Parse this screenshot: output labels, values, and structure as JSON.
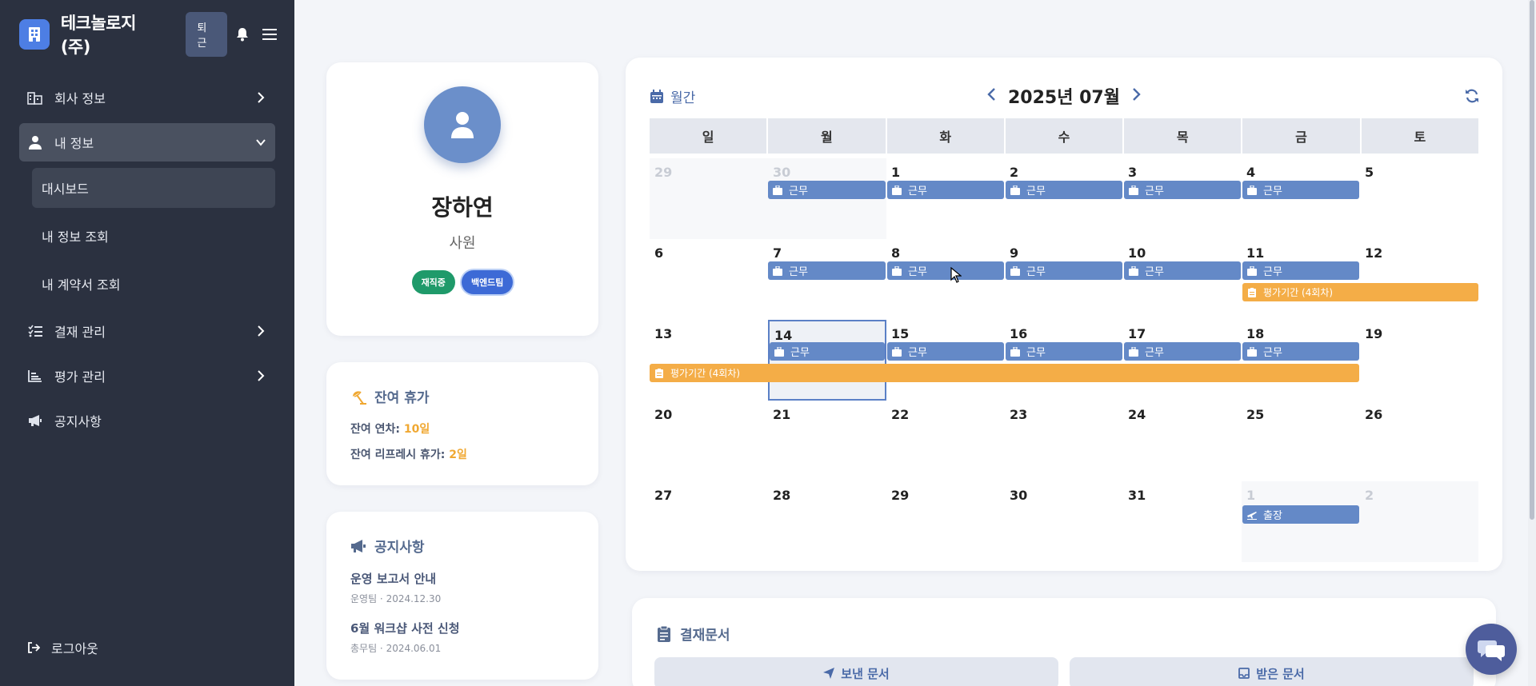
{
  "sidebar": {
    "company": "테크놀로지(주)",
    "checkout_label": "퇴근",
    "menu": [
      {
        "label": "회사 정보",
        "icon": "building-icon"
      },
      {
        "label": "내 정보",
        "icon": "user-icon"
      },
      {
        "label": "결재 관리",
        "icon": "checklist-icon"
      },
      {
        "label": "평가 관리",
        "icon": "chart-icon"
      },
      {
        "label": "공지사항",
        "icon": "megaphone-icon"
      }
    ],
    "submenu": [
      {
        "label": "대시보드"
      },
      {
        "label": "내 정보 조회"
      },
      {
        "label": "내 계약서 조회"
      }
    ],
    "logout_label": "로그아웃"
  },
  "profile": {
    "name": "장하연",
    "rank": "사원",
    "status_badge": "재직중",
    "team_badge": "백엔드팀"
  },
  "leave": {
    "title": "잔여 휴가",
    "annual_label": "잔여 연차:",
    "annual_value": "10일",
    "refresh_label": "잔여 리프레시 휴가:",
    "refresh_value": "2일"
  },
  "notice": {
    "title": "공지사항",
    "items": [
      {
        "title": "운영 보고서 안내",
        "meta": "운영팀 · 2024.12.30"
      },
      {
        "title": "6월 워크샵 사전 신청",
        "meta": "총무팀 · 2024.06.01"
      }
    ]
  },
  "calendar": {
    "mode_label": "월간",
    "title": "2025년 07월",
    "weekdays": [
      "일",
      "월",
      "화",
      "수",
      "목",
      "금",
      "토"
    ],
    "weeks": [
      [
        "29",
        "30",
        "1",
        "2",
        "3",
        "4",
        "5"
      ],
      [
        "6",
        "7",
        "8",
        "9",
        "10",
        "11",
        "12"
      ],
      [
        "13",
        "14",
        "15",
        "16",
        "17",
        "18",
        "19"
      ],
      [
        "20",
        "21",
        "22",
        "23",
        "24",
        "25",
        "26"
      ],
      [
        "27",
        "28",
        "29",
        "30",
        "31",
        "1",
        "2"
      ]
    ],
    "work_label": "근무",
    "eval_label": "평가기간 (4회차)",
    "trip_label": "출장"
  },
  "approval": {
    "title": "결재문서",
    "sent_tab": "보낸 문서",
    "received_tab": "받은 문서"
  },
  "colors": {
    "sidebar_bg": "#2b3140",
    "event_blue": "#6489c7",
    "event_orange": "#f4ad47",
    "accent": "#4d7ee4"
  }
}
